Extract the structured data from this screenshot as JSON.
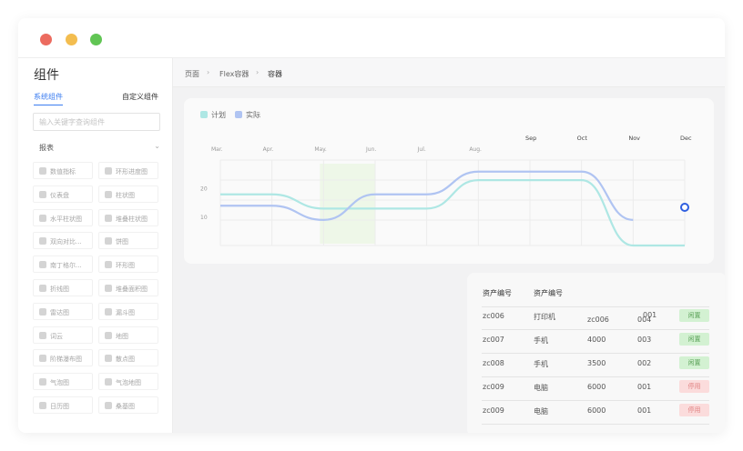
{
  "window": {
    "traffic_lights": [
      "#ec6b5f",
      "#f3bd4f",
      "#61c554"
    ]
  },
  "sidebar": {
    "title": "组件",
    "tabs": [
      {
        "label": "系统组件",
        "active": true
      },
      {
        "label": "自定义组件",
        "active": false
      }
    ],
    "search_placeholder": "输入关键字查询组件",
    "section": {
      "label": "报表",
      "chevron": "chevron-down-icon"
    },
    "items": [
      {
        "label": "数值指标",
        "icon": "number-icon"
      },
      {
        "label": "环形进度图",
        "icon": "ring-progress-icon"
      },
      {
        "label": "仪表盘",
        "icon": "gauge-icon"
      },
      {
        "label": "柱状图",
        "icon": "bar-chart-icon"
      },
      {
        "label": "水平柱状图",
        "icon": "horizontal-bar-icon"
      },
      {
        "label": "堆叠柱状图",
        "icon": "stacked-bar-icon"
      },
      {
        "label": "双向对比...",
        "icon": "bidirectional-icon"
      },
      {
        "label": "饼图",
        "icon": "pie-icon"
      },
      {
        "label": "南丁格尔...",
        "icon": "nightingale-icon"
      },
      {
        "label": "环形图",
        "icon": "donut-icon"
      },
      {
        "label": "折线图",
        "icon": "line-chart-icon"
      },
      {
        "label": "堆叠面积图",
        "icon": "stacked-area-icon"
      },
      {
        "label": "雷达图",
        "icon": "radar-icon"
      },
      {
        "label": "漏斗图",
        "icon": "funnel-icon"
      },
      {
        "label": "词云",
        "icon": "word-cloud-icon"
      },
      {
        "label": "地图",
        "icon": "map-icon"
      },
      {
        "label": "阶梯瀑布图",
        "icon": "waterfall-icon"
      },
      {
        "label": "散点图",
        "icon": "scatter-icon"
      },
      {
        "label": "气泡图",
        "icon": "bubble-icon"
      },
      {
        "label": "气泡地图",
        "icon": "bubble-map-icon"
      },
      {
        "label": "日历图",
        "icon": "calendar-icon"
      },
      {
        "label": "桑基图",
        "icon": "sankey-icon"
      }
    ]
  },
  "breadcrumb": [
    {
      "label": "页面"
    },
    {
      "label": "Flex容器"
    },
    {
      "label": "容器"
    }
  ],
  "breadcrumb_separator": "›",
  "chart_data": {
    "type": "line",
    "categories": [
      "Mar.",
      "Apr.",
      "May.",
      "Jun.",
      "Jul.",
      "Aug.",
      "Sep",
      "Oct",
      "Nov",
      "Dec"
    ],
    "series": [
      {
        "name": "计划",
        "color": "#aee7e4",
        "values": [
          18,
          18,
          13,
          13,
          13,
          23,
          23,
          23,
          0,
          0
        ]
      },
      {
        "name": "实际",
        "color": "#b0c4f2",
        "values": [
          14,
          14,
          9,
          18,
          18,
          26,
          26,
          26,
          9,
          null
        ]
      }
    ],
    "y_tick_labels": [
      "20",
      "10"
    ],
    "ylim": [
      0,
      32
    ],
    "grid": true,
    "legend_position": "top-left",
    "highlight_band_color": "#eef7e8",
    "marker_color": "#2f5fe0"
  },
  "table": {
    "headers": [
      "资产编号",
      "资产编号"
    ],
    "overlay_values": [
      "zc006",
      "004",
      "001"
    ],
    "rows": [
      {
        "id": "zc006",
        "name": "打印机",
        "price": "",
        "num": "",
        "status": "闲置",
        "state": "idle"
      },
      {
        "id": "zc007",
        "name": "手机",
        "price": "4000",
        "num": "003",
        "status": "闲置",
        "state": "idle"
      },
      {
        "id": "zc008",
        "name": "手机",
        "price": "3500",
        "num": "002",
        "status": "闲置",
        "state": "idle"
      },
      {
        "id": "zc009",
        "name": "电脑",
        "price": "6000",
        "num": "001",
        "status": "停用",
        "state": "stop"
      },
      {
        "id": "zc009",
        "name": "电脑",
        "price": "6000",
        "num": "001",
        "status": "停用",
        "state": "stop"
      }
    ]
  }
}
